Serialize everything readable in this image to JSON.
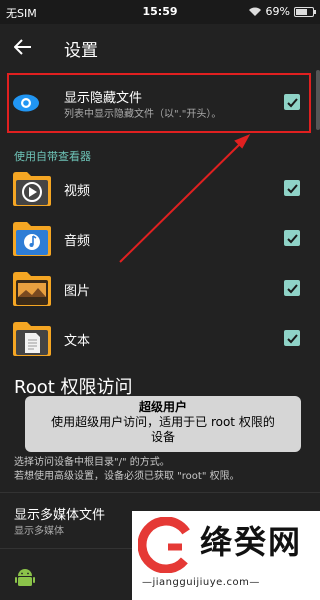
{
  "status_bar": {
    "carrier": "无SIM",
    "time": "15:59",
    "battery": "69%",
    "battery_level": 0.69
  },
  "header": {
    "title": "设置"
  },
  "show_hidden": {
    "title": "显示隐藏文件",
    "subtitle": "列表中显示隐藏文件（以\".\"开头）。",
    "checked": true
  },
  "viewer_section": {
    "header": "使用自带查看器",
    "items": [
      {
        "label": "视频",
        "checked": true
      },
      {
        "label": "音频",
        "checked": true
      },
      {
        "label": "图片",
        "checked": true
      },
      {
        "label": "文本",
        "checked": true
      }
    ]
  },
  "root_access": {
    "title": "Root 权限访问",
    "toast_title": "超级用户",
    "toast_line1": "使用超级用户访问，适用于已 root 权限的",
    "toast_line2": "设备",
    "desc_line1": "选择访问设备中根目录\"/\" 的方式。",
    "desc_line2": "若想使用高级设置，设备必须已获取 \"root\" 权限。"
  },
  "multimedia": {
    "title": "显示多媒体文件",
    "subtitle": "显示多媒体"
  },
  "watermark": {
    "name": "绛癸网",
    "url": "—jiangguijiuye.com—"
  },
  "colors": {
    "accent": "#8fd3c7",
    "highlight": "#e02020",
    "section": "#6ec4b8"
  }
}
